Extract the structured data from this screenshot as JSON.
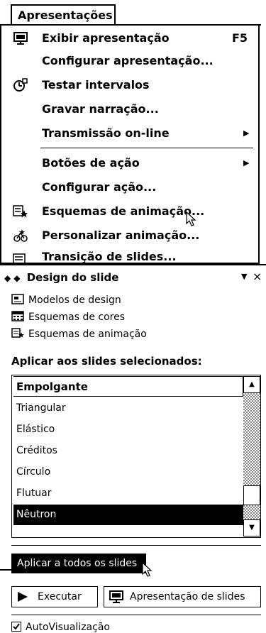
{
  "menu": {
    "title": "Apresentações",
    "items": [
      {
        "label": "Exibir apresentação",
        "shortcut": "F5",
        "icon": "slideshow-icon"
      },
      {
        "label": "Configurar apresentação...",
        "icon": ""
      },
      {
        "label": "Testar intervalos",
        "icon": "rehearse-timings-icon"
      },
      {
        "label": "Gravar narração...",
        "icon": ""
      },
      {
        "label": "Transmissão on-line",
        "submenu": true,
        "icon": ""
      },
      {
        "label": "Botões de ação",
        "submenu": true,
        "icon": ""
      },
      {
        "label": "Configurar ação...",
        "icon": ""
      },
      {
        "label": "Esquemas de animação...",
        "icon": "animation-schemes-icon"
      },
      {
        "label": "Personalizar animação...",
        "icon": "custom-animation-icon"
      },
      {
        "label": "Transição de slides...",
        "icon": "slide-transition-icon"
      }
    ]
  },
  "task_pane": {
    "title": "Design do slide",
    "links": [
      {
        "label": "Modelos de design",
        "icon": "design-templates-icon"
      },
      {
        "label": "Esquemas de cores",
        "icon": "color-schemes-icon"
      },
      {
        "label": "Esquemas de animação",
        "icon": "animation-schemes-icon"
      }
    ],
    "section_label": "Aplicar aos slides selecionados:",
    "list": [
      "Empolgante",
      "Triangular",
      "Elástico",
      "Créditos",
      "Círculo",
      "Flutuar",
      "Nêutron"
    ],
    "selected": "Nêutron",
    "apply_all": "Aplicar a todos os slides",
    "run_button": "Executar",
    "slideshow_button": "Apresentação de slides",
    "autopreview": "AutoVisualização",
    "autopreview_checked": true
  }
}
